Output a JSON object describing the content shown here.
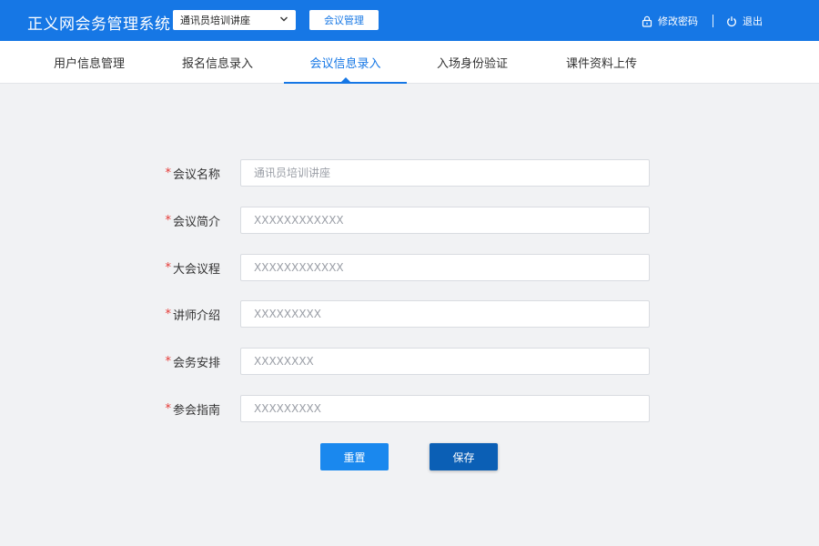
{
  "header": {
    "app_title": "正义网会务管理系统",
    "meeting_select_value": "通讯员培训讲座",
    "manage_button": "会议管理",
    "change_password": "修改密码",
    "logout": "退出",
    "accent_color": "#1677e5"
  },
  "tabs": [
    {
      "label": "用户信息管理",
      "active": false
    },
    {
      "label": "报名信息录入",
      "active": false
    },
    {
      "label": "会议信息录入",
      "active": true
    },
    {
      "label": "入场身份验证",
      "active": false
    },
    {
      "label": "课件资料上传",
      "active": false
    }
  ],
  "form": {
    "required_mark": "*",
    "fields": [
      {
        "label": "会议名称",
        "placeholder": "通讯员培训讲座"
      },
      {
        "label": "会议简介",
        "placeholder": "XXXXXXXXXXXX"
      },
      {
        "label": "大会议程",
        "placeholder": "XXXXXXXXXXXX"
      },
      {
        "label": "讲师介绍",
        "placeholder": "XXXXXXXXX"
      },
      {
        "label": "会务安排",
        "placeholder": "XXXXXXXX"
      },
      {
        "label": "参会指南",
        "placeholder": "XXXXXXXXX"
      }
    ],
    "reset_button": "重置",
    "save_button": "保存"
  }
}
